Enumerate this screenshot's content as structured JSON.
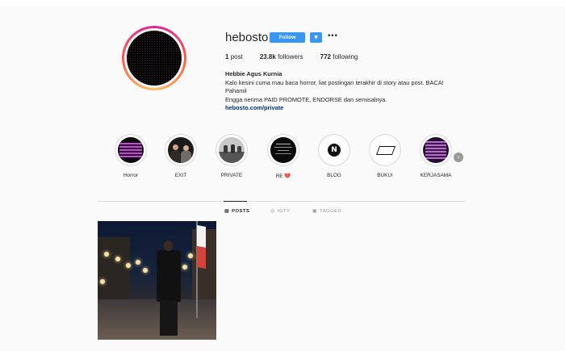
{
  "profile": {
    "username": "hebosto",
    "follow_label": "Follow",
    "dropdown_icon": "chevron-down-icon",
    "more_icon": "more-options-icon",
    "stats": {
      "posts_count": "1",
      "posts_label": "post",
      "followers_count": "23.8k",
      "followers_label": "followers",
      "following_count": "772",
      "following_label": "following"
    },
    "bio": {
      "name": "Hebbie Agus Kurnia",
      "line1": "Kalo kesini cuma mau baca horror, liat postingan terakhir di story atau post. BACA!",
      "line2": "Pahamil",
      "line3": "Engga nerima PAID PROMOTE, ENDORSE dan semisalnya.",
      "link": "hebosto.com/private"
    }
  },
  "highlights": [
    {
      "label": "Horror"
    },
    {
      "label": "EXIT"
    },
    {
      "label": "PRIVATE"
    },
    {
      "label": "RE 💔"
    },
    {
      "label": "BLOG"
    },
    {
      "label": "BUKU!"
    },
    {
      "label": "KERJASAMA"
    }
  ],
  "tabs": [
    {
      "label": "POSTS",
      "icon": "grid-icon",
      "active": true
    },
    {
      "label": "IGTV",
      "icon": "igtv-icon",
      "active": false
    },
    {
      "label": "TAGGED",
      "icon": "tagged-icon",
      "active": false
    }
  ],
  "colors": {
    "accent": "#3897f0",
    "background": "#fafafa",
    "link": "#003569",
    "muted": "#999999"
  }
}
